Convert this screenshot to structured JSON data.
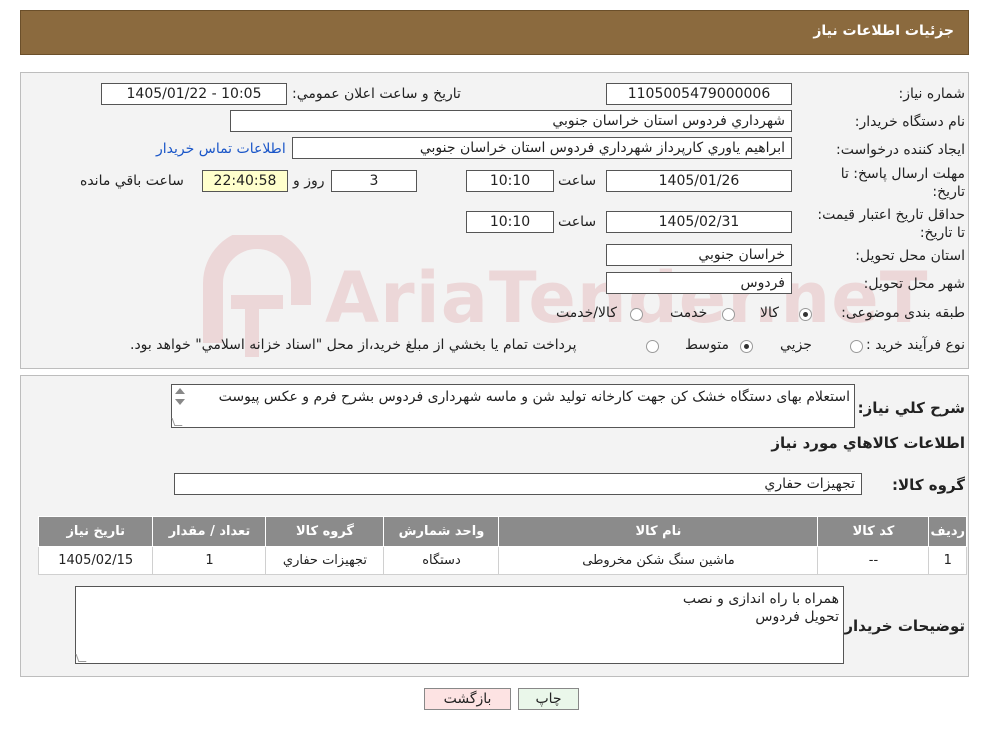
{
  "header": {
    "title": "جزئیات اطلاعات نیاز"
  },
  "fields": {
    "need_number_label": "شماره نیاز:",
    "need_number": "1105005479000006",
    "announce_label": "تاریخ و ساعت اعلان عمومي:",
    "announce_value": "1405/01/22 - 10:05",
    "buyer_org_label": "نام دستگاه خريدار:",
    "buyer_org": "شهرداري فردوس استان خراسان جنوبي",
    "creator_label": "ايجاد کننده درخواست:",
    "creator": "ابراهيم ياوري كارپرداز شهرداري فردوس استان خراسان جنوبي",
    "contact_link": "اطلاعات تماس خريدار",
    "deadline_label": "مهلت ارسال پاسخ: تا تاریخ:",
    "deadline_date": "1405/01/26",
    "time_label": "ساعت",
    "deadline_time": "10:10",
    "days": "3",
    "days_label": "روز و",
    "remaining_time": "22:40:58",
    "remaining_label": "ساعت باقي مانده",
    "price_validity_label": "حداقل تاريخ اعتبار قيمت: تا تاريخ:",
    "price_validity_date": "1405/02/31",
    "price_validity_time": "10:10",
    "province_label": "استان محل تحويل:",
    "province": "خراسان جنوبي",
    "city_label": "شهر محل تحويل:",
    "city": "فردوس",
    "category_label": "طبقه بندی موضوعی:",
    "category_options": [
      "كالا",
      "خدمت",
      "كالا/خدمت"
    ],
    "process_label": "نوع فرآيند خريد :",
    "process_options": [
      "جزيي",
      "متوسط"
    ],
    "process_note": "پرداخت تمام يا بخشي از مبلغ خريد،از محل \"اسناد خزانه اسلامي\" خواهد بود."
  },
  "description": {
    "label": "شرح كلي نياز:",
    "text": "استعلام بهای دستگاه خشک کن جهت کارخانه تولید شن و ماسه شهرداری فردوس بشرح فرم و عکس پیوست"
  },
  "goods": {
    "section_title": "اطلاعات كالاهاي مورد نياز",
    "group_label": "گروه كالا:",
    "group_value": "تجهيزات حفاري",
    "columns": [
      "رديف",
      "كد كالا",
      "نام كالا",
      "واحد شمارش",
      "گروه كالا",
      "تعداد / مقدار",
      "تاريخ نياز"
    ],
    "rows": [
      [
        "1",
        "--",
        "ماشين سنگ شكن مخروطی",
        "دستگاه",
        "تجهيزات حفاري",
        "1",
        "1405/02/15"
      ]
    ]
  },
  "buyer_notes": {
    "label": "توضيحات خريدار:",
    "line1": "همراه با راه اندازی و نصب",
    "line2": "تحویل فردوس"
  },
  "buttons": {
    "print": "چاپ",
    "back": "بازگشت"
  },
  "watermark": {
    "text": "AriaTender.neT"
  }
}
